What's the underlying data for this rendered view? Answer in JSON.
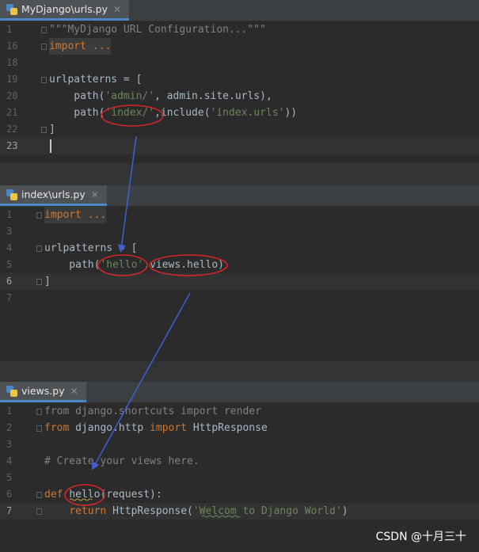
{
  "panels": [
    {
      "tab_title": "MyDjango\\urls.py",
      "close_glyph": "✕",
      "lines": [
        {
          "n": "1",
          "spans": [
            {
              "t": "\"\"\"MyDjango URL Configuration...\"\"\"",
              "c": "cmt"
            }
          ]
        },
        {
          "n": "16",
          "spans": [
            {
              "t": "import ...",
              "c": "kw"
            }
          ]
        },
        {
          "n": "18",
          "spans": []
        },
        {
          "n": "19",
          "spans": [
            {
              "t": "urlpatterns = [",
              "c": ""
            }
          ]
        },
        {
          "n": "20",
          "spans": [
            {
              "t": "    path(",
              "c": ""
            },
            {
              "t": "'admin/'",
              "c": "str"
            },
            {
              "t": ", admin.site.urls),",
              "c": ""
            }
          ]
        },
        {
          "n": "21",
          "spans": [
            {
              "t": "    path(",
              "c": ""
            },
            {
              "t": "'index/'",
              "c": "str"
            },
            {
              "t": ",include(",
              "c": ""
            },
            {
              "t": "'index.urls'",
              "c": "str"
            },
            {
              "t": "))",
              "c": ""
            }
          ]
        },
        {
          "n": "22",
          "spans": [
            {
              "t": "]",
              "c": ""
            }
          ]
        },
        {
          "n": "23",
          "spans": []
        }
      ]
    },
    {
      "tab_title": "index\\urls.py",
      "close_glyph": "✕",
      "lines": [
        {
          "n": "1",
          "spans": [
            {
              "t": "import ...",
              "c": "kw"
            }
          ]
        },
        {
          "n": "3",
          "spans": []
        },
        {
          "n": "4",
          "spans": [
            {
              "t": "urlpatterns = [",
              "c": ""
            }
          ]
        },
        {
          "n": "5",
          "spans": [
            {
              "t": "    path(",
              "c": ""
            },
            {
              "t": "'hello'",
              "c": "str"
            },
            {
              "t": ",views.hello)",
              "c": ""
            }
          ]
        },
        {
          "n": "6",
          "spans": [
            {
              "t": "]",
              "c": ""
            }
          ]
        },
        {
          "n": "7",
          "spans": []
        }
      ]
    },
    {
      "tab_title": "views.py",
      "close_glyph": "✕",
      "lines": [
        {
          "n": "1",
          "spans": [
            {
              "t": "from django.shortcuts import render",
              "c": "cmt"
            }
          ]
        },
        {
          "n": "2",
          "spans": [
            {
              "t": "from ",
              "c": "kw"
            },
            {
              "t": "django.http ",
              "c": ""
            },
            {
              "t": "import ",
              "c": "kw"
            },
            {
              "t": "HttpResponse",
              "c": ""
            }
          ]
        },
        {
          "n": "3",
          "spans": []
        },
        {
          "n": "4",
          "spans": [
            {
              "t": "# Create your views here.",
              "c": "cmt"
            }
          ]
        },
        {
          "n": "5",
          "spans": []
        },
        {
          "n": "6",
          "spans": [
            {
              "t": "def ",
              "c": "kw"
            },
            {
              "t": "hello(request):",
              "c": ""
            }
          ]
        },
        {
          "n": "7",
          "spans": [
            {
              "t": "    ",
              "c": ""
            },
            {
              "t": "return ",
              "c": "kw"
            },
            {
              "t": "HttpResponse(",
              "c": ""
            },
            {
              "t": "'Welcom to Django World'",
              "c": "str"
            },
            {
              "t": ")",
              "c": ""
            }
          ]
        }
      ]
    }
  ],
  "watermark": "CSDN @十月三十",
  "colors": {
    "editor_bg": "#2b2b2b",
    "keyword": "#cc7832",
    "string": "#6a8759",
    "comment": "#808080",
    "annotation_red": "#d8262b",
    "annotation_arrow": "#3f5fd6"
  }
}
